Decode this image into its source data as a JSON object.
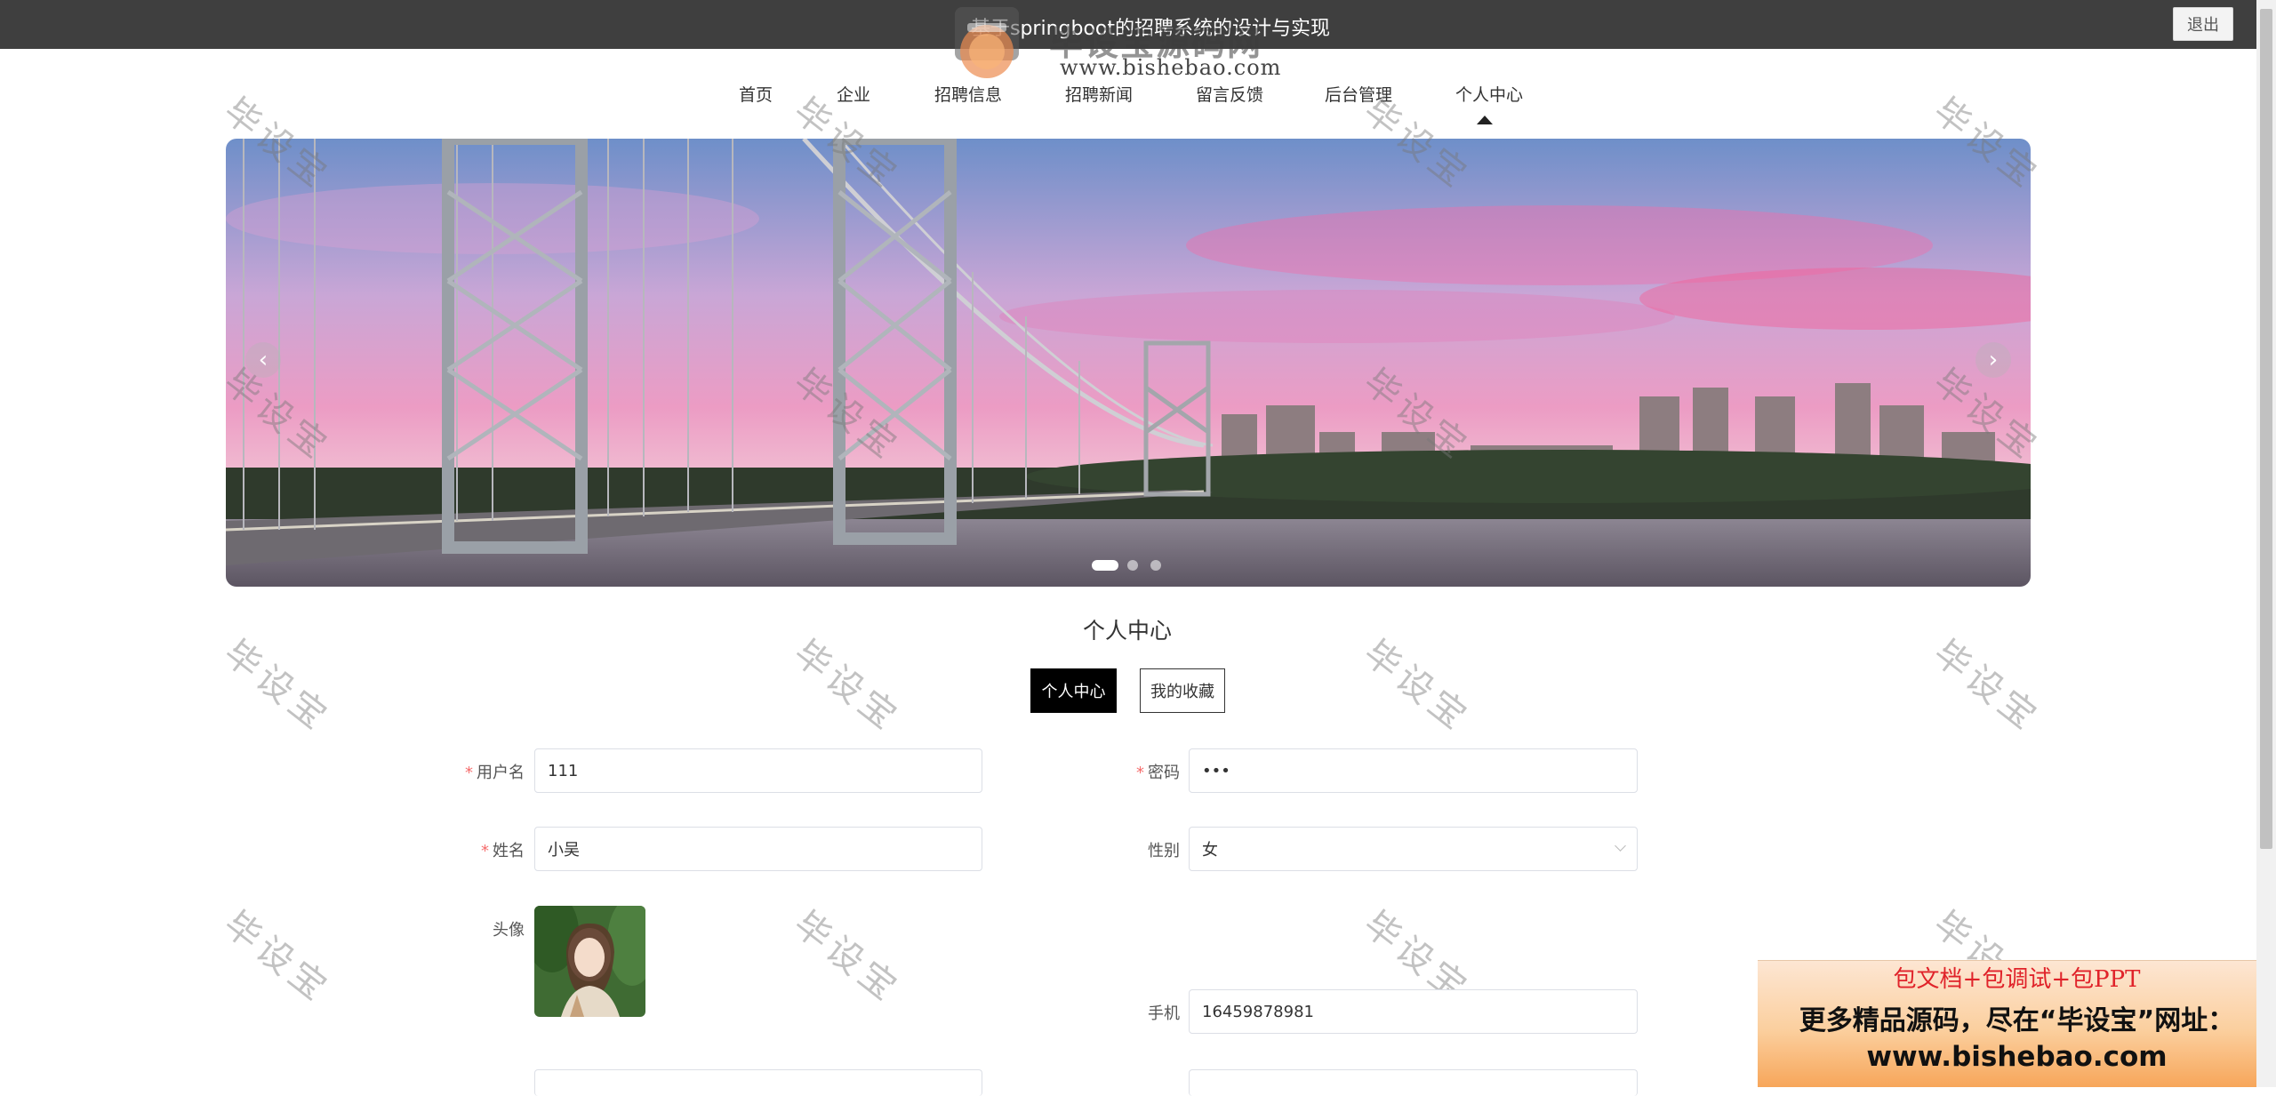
{
  "header": {
    "title": "基于springboot的招聘系统的设计与实现",
    "logout_label": "退出"
  },
  "brand": {
    "name": "毕设宝源码网",
    "url": "www.bishebao.com"
  },
  "nav": {
    "items": [
      {
        "label": "首页"
      },
      {
        "label": "企业"
      },
      {
        "label": "招聘信息"
      },
      {
        "label": "招聘新闻"
      },
      {
        "label": "留言反馈"
      },
      {
        "label": "后台管理"
      },
      {
        "label": "个人中心",
        "active": true
      }
    ]
  },
  "carousel": {
    "prev_icon": "chevron-left-icon",
    "next_icon": "chevron-right-icon",
    "prev_glyph": "‹",
    "next_glyph": "›",
    "slide_count": 3,
    "active_slide": 1
  },
  "section": {
    "title": "个人中心",
    "tabs": [
      {
        "label": "个人中心",
        "active": true
      },
      {
        "label": "我的收藏",
        "active": false
      }
    ]
  },
  "form": {
    "required_mark": "*",
    "username": {
      "label": "用户名",
      "value": "111",
      "required": true
    },
    "password": {
      "label": "密码",
      "value": "•••",
      "required": true
    },
    "name": {
      "label": "姓名",
      "value": "小吴",
      "required": true
    },
    "gender": {
      "label": "性别",
      "value": "女"
    },
    "avatar": {
      "label": "头像"
    },
    "phone": {
      "label": "手机",
      "value": "16459878981"
    }
  },
  "watermark": {
    "text": "毕设宝"
  },
  "ad": {
    "line1": "包文档+包调试+包PPT",
    "line2": "更多精品源码，尽在“毕设宝”网址：",
    "line3": "www.bishebao.com"
  },
  "colors": {
    "topbar": "#3f3f3f",
    "required": "#f56c6c",
    "active_tab": "#000000",
    "ad_red": "#e0232a"
  }
}
